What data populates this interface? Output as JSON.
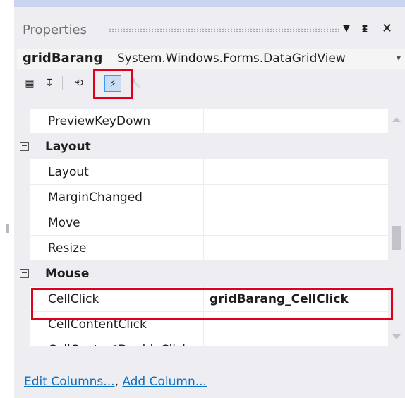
{
  "header": {
    "title": "Properties",
    "dropdown_icon": "▼",
    "pin_icon": "ᵻ",
    "close_icon": "✕"
  },
  "object": {
    "name": "gridBarang",
    "type": "System.Windows.Forms.DataGridView",
    "dropdown_icon": "▾"
  },
  "toolbar": {
    "categorized_icon": "▦",
    "alphabetical_icon": "↧",
    "properties_icon": "⟲",
    "events_icon": "⚡",
    "property_pages_icon": "🔧"
  },
  "grid": {
    "rows": [
      {
        "kind": "prop",
        "name": "PreviewKeyDown",
        "value": ""
      },
      {
        "kind": "category",
        "toggle": "−",
        "name": "Layout"
      },
      {
        "kind": "prop",
        "name": "Layout",
        "value": ""
      },
      {
        "kind": "prop",
        "name": "MarginChanged",
        "value": ""
      },
      {
        "kind": "prop",
        "name": "Move",
        "value": ""
      },
      {
        "kind": "prop",
        "name": "Resize",
        "value": ""
      },
      {
        "kind": "category",
        "toggle": "−",
        "name": "Mouse"
      },
      {
        "kind": "prop",
        "name": "CellClick",
        "value": "gridBarang_CellClick"
      },
      {
        "kind": "prop",
        "name": "CellContentClick",
        "value": ""
      },
      {
        "kind": "prop",
        "name": "CellContentDoubleClick",
        "value": ""
      }
    ]
  },
  "footer": {
    "edit_columns": "Edit Columns...",
    "separator": ", ",
    "add_column": "Add Column..."
  },
  "colors": {
    "highlight": "#e0001b",
    "link": "#0e70c0",
    "panel": "#eeeef2"
  }
}
